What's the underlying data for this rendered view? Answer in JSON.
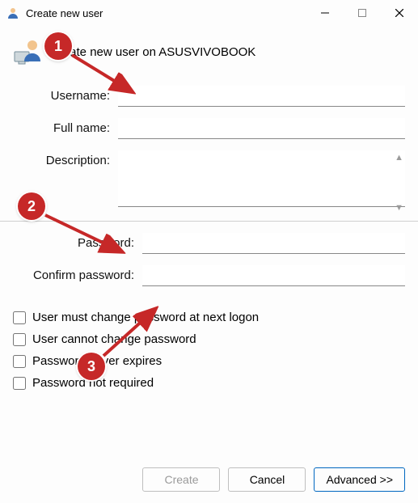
{
  "window": {
    "title": "Create new user"
  },
  "header": {
    "text": "Create new user on ASUSVIVOBOOK"
  },
  "labels": {
    "username": "Username:",
    "fullname": "Full name:",
    "description": "Description:",
    "password": "Password:",
    "confirm": "Confirm password:"
  },
  "fields": {
    "username": "",
    "fullname": "",
    "description": "",
    "password": "",
    "confirm": ""
  },
  "checkboxes": {
    "must_change": "User must change password at next logon",
    "cannot_change": "User cannot change password",
    "never_expires": "Password never expires",
    "not_required": "Password not required"
  },
  "buttons": {
    "create": "Create",
    "cancel": "Cancel",
    "advanced": "Advanced >>"
  },
  "annotations": {
    "b1": "1",
    "b2": "2",
    "b3": "3"
  }
}
